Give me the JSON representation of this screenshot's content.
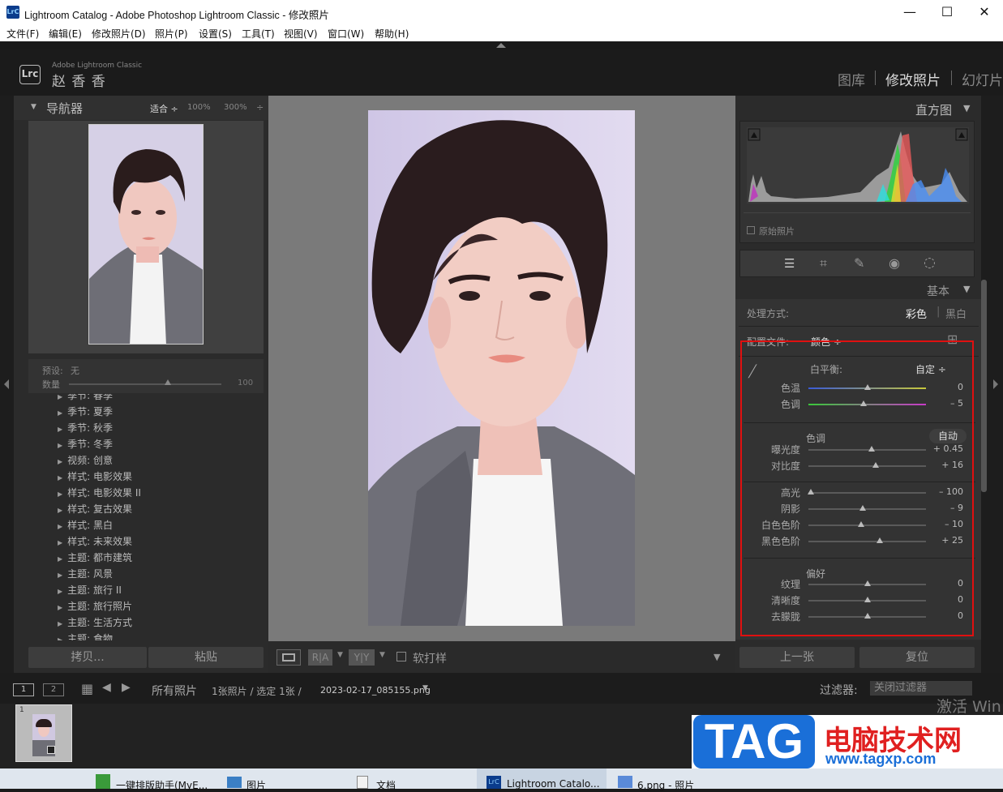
{
  "window": {
    "title": "Lightroom Catalog - Adobe Photoshop Lightroom Classic - 修改照片",
    "logo_text": "LrC",
    "minimize": "—",
    "maximize": "☐",
    "close": "✕"
  },
  "menu": [
    "文件(F)",
    "编辑(E)",
    "修改照片(D)",
    "照片(P)",
    "设置(S)",
    "工具(T)",
    "视图(V)",
    "窗口(W)",
    "帮助(H)"
  ],
  "identity": {
    "logo": "Lrc",
    "product": "Adobe Lightroom Classic",
    "user": "赵 香 香"
  },
  "modules": [
    "图库",
    "修改照片",
    "幻灯片"
  ],
  "navigator": {
    "title": "导航器",
    "fit": "适合 ÷",
    "zoom100": "100%",
    "zoom300": "300%",
    "zoom_menu": "÷"
  },
  "preset_box": {
    "preset_label": "预设:",
    "preset_value": "无",
    "amount_label": "数量",
    "amount_value": "100",
    "amount": 0.65
  },
  "presets": [
    "季节: 春季",
    "季节: 夏季",
    "季节: 秋季",
    "季节: 冬季",
    "视频: 创意",
    "样式: 电影效果",
    "样式: 电影效果 II",
    "样式: 复古效果",
    "样式: 黑白",
    "样式: 未来效果",
    "主题: 都市建筑",
    "主题: 风景",
    "主题: 旅行 II",
    "主题: 旅行照片",
    "主题: 生活方式",
    "主题: 食物"
  ],
  "left_buttons": {
    "copy": "拷贝...",
    "paste": "粘贴"
  },
  "toolbar": {
    "ra": "R|A",
    "yy": "Y|Y",
    "softproof": "软打样"
  },
  "histogram": {
    "title": "直方图",
    "original": "原始照片"
  },
  "basic": {
    "title": "基本",
    "treatment_label": "处理方式:",
    "treatment_color": "彩色",
    "treatment_bw": "黑白",
    "profile_label": "配置文件:",
    "profile_value": "颜色 ÷",
    "wb_label": "白平衡:",
    "wb_value": "自定 ÷",
    "tone_label": "色调",
    "auto": "自动",
    "presence_label": "偏好",
    "sliders": [
      {
        "label": "色温",
        "value": "0",
        "pos": 0.5
      },
      {
        "label": "色调",
        "value": "– 5",
        "pos": 0.47
      },
      {
        "label": "曝光度",
        "value": "+ 0.45",
        "pos": 0.54
      },
      {
        "label": "对比度",
        "value": "+ 16",
        "pos": 0.57
      },
      {
        "label": "高光",
        "value": "– 100",
        "pos": 0.02
      },
      {
        "label": "阴影",
        "value": "– 9",
        "pos": 0.46
      },
      {
        "label": "白色色阶",
        "value": "– 10",
        "pos": 0.45
      },
      {
        "label": "黑色色阶",
        "value": "+ 25",
        "pos": 0.61
      },
      {
        "label": "纹理",
        "value": "0",
        "pos": 0.5
      },
      {
        "label": "清晰度",
        "value": "0",
        "pos": 0.5
      },
      {
        "label": "去朦胧",
        "value": "0",
        "pos": 0.5
      }
    ]
  },
  "right_buttons": {
    "prev": "上一张",
    "reset": "复位"
  },
  "bottombar": {
    "view1": "1",
    "view2": "2",
    "source": "所有照片",
    "count": "1张照片 / 选定 1张 /",
    "filename": "2023-02-17_085155.png",
    "filter_label": "过滤器:",
    "filter_value": "关闭过滤器"
  },
  "filmstrip": {
    "index": "1"
  },
  "watermark": {
    "activate": "激活 Win",
    "tag": "TAG",
    "site_title": "电脑技术网",
    "site_url": "www.tagxp.com"
  },
  "taskbar": [
    "一键排版助手(MyE...",
    "图片",
    "文档",
    "Lightroom Catalo...",
    "6.png - 照片"
  ]
}
